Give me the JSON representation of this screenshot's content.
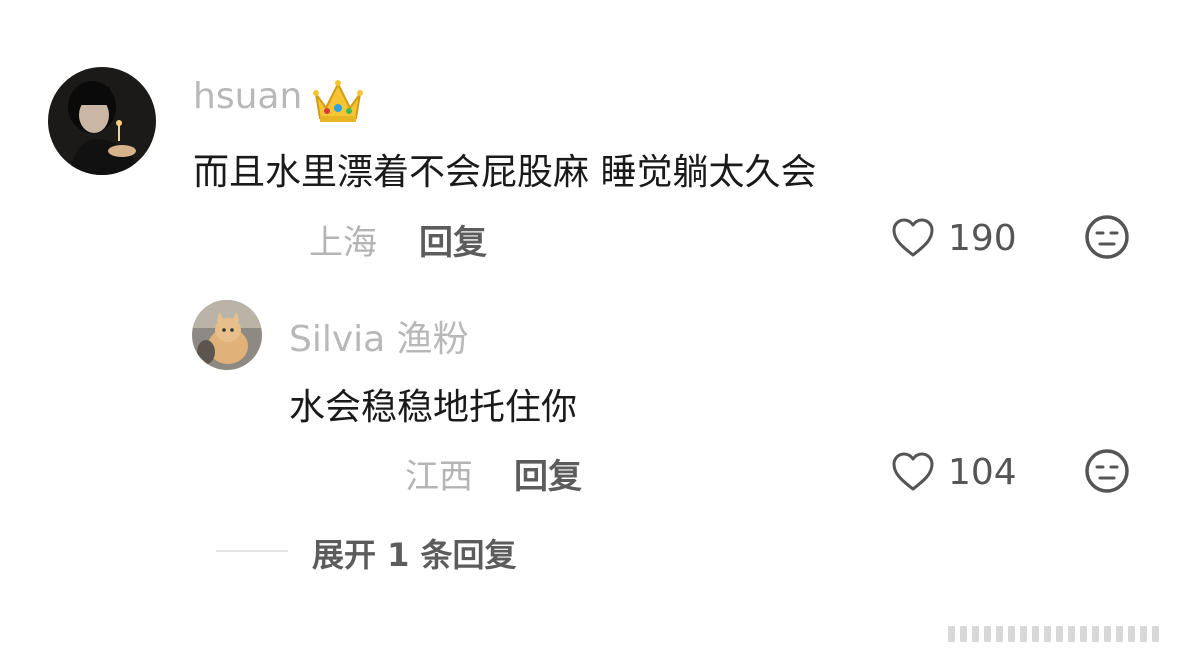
{
  "comments": [
    {
      "username": "hsuan",
      "badge_icon": "crown-emoji",
      "text": "而且水里漂着不会屁股麻 睡觉躺太久会",
      "location": "上海",
      "reply_label": "回复",
      "likes": "190",
      "reaction_icon": "neutral-face-icon"
    },
    {
      "username": "Silvia 渔粉",
      "text": "水会稳稳地托住你",
      "location": "江西",
      "reply_label": "回复",
      "likes": "104",
      "reaction_icon": "neutral-face-icon"
    }
  ],
  "expand_replies_label": "展开 1 条回复",
  "colors": {
    "username": "#b8b8b8",
    "content": "#1a1a1a",
    "meta": "#b4b4b4",
    "action": "#5c5c5c"
  }
}
